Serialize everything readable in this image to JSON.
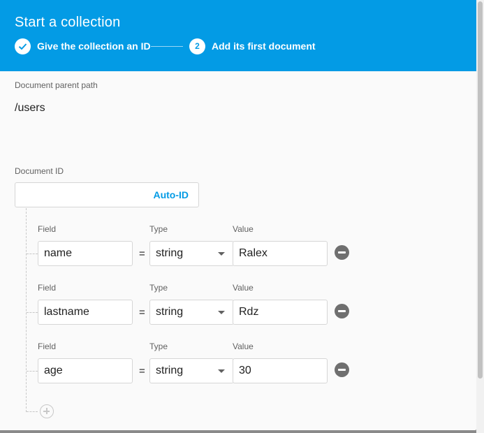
{
  "header": {
    "title": "Start a collection",
    "steps": [
      {
        "number": "1",
        "label": "Give the collection an ID",
        "state": "completed"
      },
      {
        "number": "2",
        "label": "Add its first document",
        "state": "active"
      }
    ]
  },
  "parent_path": {
    "label": "Document parent path",
    "value": "/users"
  },
  "document_id": {
    "label": "Document ID",
    "value": "",
    "auto_id_label": "Auto-ID"
  },
  "fields_header": {
    "field": "Field",
    "type": "Type",
    "value": "Value"
  },
  "fields": [
    {
      "field": "name",
      "type": "string",
      "value": "Ralex"
    },
    {
      "field": "lastname",
      "type": "string",
      "value": "Rdz"
    },
    {
      "field": "age",
      "type": "string",
      "value": "30"
    }
  ],
  "equals_sign": "=",
  "colors": {
    "header_bg": "#039be5",
    "accent": "#039be5",
    "remove_button": "#6f6f6f"
  },
  "icons": {
    "step_done": "check-icon",
    "remove": "remove-circle-icon",
    "add": "add-circle-icon",
    "dropdown": "caret-down-icon"
  }
}
